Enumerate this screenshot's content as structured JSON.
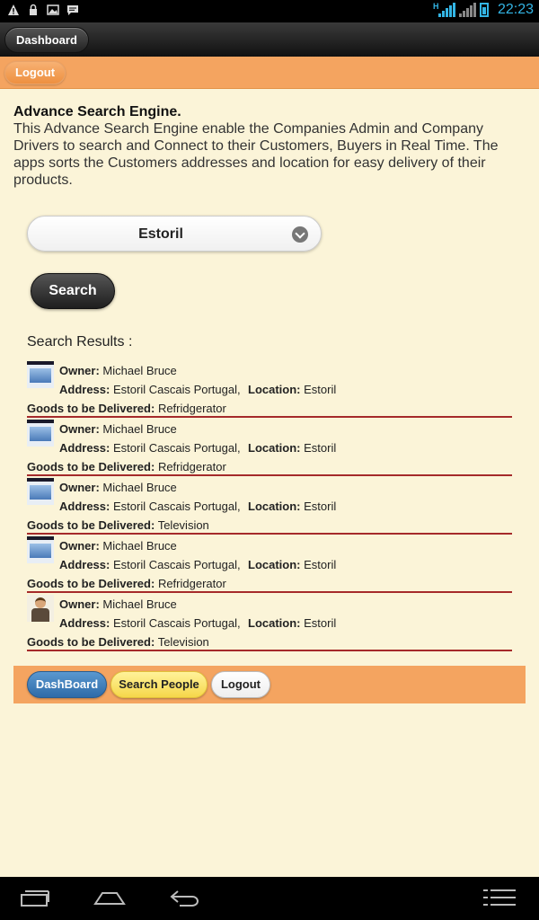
{
  "status_bar": {
    "left_icons": [
      "warning-icon",
      "lock-icon",
      "image-icon",
      "chat-icon"
    ],
    "network_badge": "H",
    "time": "22:23"
  },
  "header": {
    "dashboard_label": "Dashboard"
  },
  "top_bar": {
    "logout_label": "Logout"
  },
  "intro": {
    "title": "Advance Search Engine.",
    "body": "This Advance Search Engine enable the Companies Admin and Company Drivers to search and Connect to their Customers, Buyers in Real Time. The apps sorts the Customers addresses and location for easy delivery of their products."
  },
  "search": {
    "selected_location": "Estoril",
    "button_label": "Search",
    "results_title": "Search Results :"
  },
  "labels": {
    "owner": "Owner:",
    "address": "Address:",
    "location": "Location:",
    "goods": "Goods to be Delivered:"
  },
  "results": [
    {
      "thumb": "screenshot-thumbnail",
      "owner": "Michael Bruce",
      "address": "Estoril Cascais Portugal,",
      "location": "Estoril",
      "goods": "Refridgerator"
    },
    {
      "thumb": "screenshot-thumbnail",
      "owner": "Michael Bruce",
      "address": "Estoril Cascais Portugal,",
      "location": "Estoril",
      "goods": "Refridgerator"
    },
    {
      "thumb": "screenshot-thumbnail",
      "owner": "Michael Bruce",
      "address": "Estoril Cascais Portugal,",
      "location": "Estoril",
      "goods": "Television"
    },
    {
      "thumb": "screenshot-thumbnail",
      "owner": "Michael Bruce",
      "address": "Estoril Cascais Portugal,",
      "location": "Estoril",
      "goods": "Refridgerator"
    },
    {
      "thumb": "person-thumbnail",
      "owner": "Michael Bruce",
      "address": "Estoril Cascais Portugal,",
      "location": "Estoril",
      "goods": "Television"
    }
  ],
  "footer": {
    "dashboard_label": "DashBoard",
    "search_people_label": "Search People",
    "logout_label": "Logout"
  },
  "nav_bar": [
    "recent-apps-icon",
    "home-icon",
    "back-icon",
    "menu-icon"
  ],
  "colors": {
    "background": "#fbf4d8",
    "accent_orange": "#f4a460",
    "divider": "#a52a2a",
    "status_blue": "#33b5e5"
  }
}
